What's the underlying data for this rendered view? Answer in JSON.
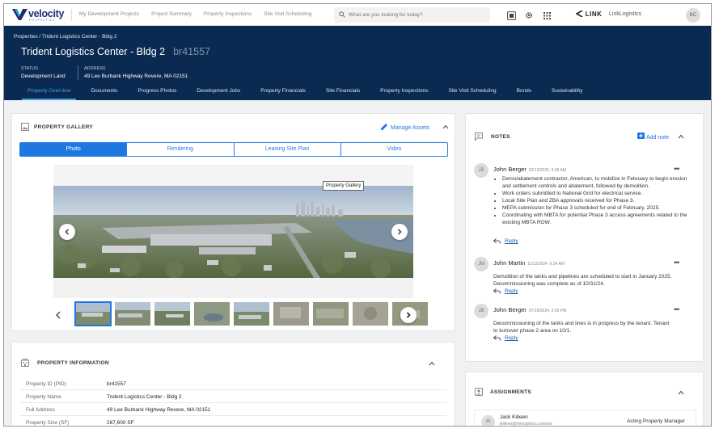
{
  "app": {
    "logo_text": "velocity",
    "logo_sub": "PROPERTIES",
    "nav": [
      "My Development Projects",
      "Project Summary",
      "Property Inspections",
      "Site Visit Scheduling"
    ],
    "search_placeholder": "What are you looking for today?",
    "partner_logo": "LINK",
    "tenant_name": "LinkLogistics",
    "user_initials": "BC"
  },
  "header": {
    "breadcrumb": "Properties / Trident Logistics Center - Bldg 2",
    "title": "Trident Logistics Center - Bldg 2",
    "property_code": "br41557",
    "status_label": "STATUS",
    "status_value": "Development Land",
    "address_label": "ADDRESS",
    "address_value": "49 Lee Burbank Highway Revere, MA 02151",
    "tabs": [
      "Property Overview",
      "Documents",
      "Progress Photos",
      "Development Jobs",
      "Property Financials",
      "Site Financials",
      "Property Inspections",
      "Site Visit Scheduling",
      "Bonds",
      "Sustainability"
    ],
    "active_tab": 0
  },
  "gallery": {
    "title": "PROPERTY GALLERY",
    "manage_label": "Manage Assets",
    "media_tabs": [
      "Photo",
      "Rendering",
      "Leasing Site Plan",
      "Video"
    ],
    "active_media_tab": 0,
    "tooltip": "Property Gallery",
    "thumbnail_count": 9
  },
  "info": {
    "title": "PROPERTY INFORMATION",
    "rows": [
      {
        "label": "Property ID (PID)",
        "value": "br41557"
      },
      {
        "label": "Property Name",
        "value": "Trident Logistics Center - Bldg 2"
      },
      {
        "label": "Full Address",
        "value": "49 Lee Burbank Highway Revere, MA 02151"
      },
      {
        "label": "Property Size (SF)",
        "value": "267,600 SF"
      }
    ]
  },
  "notes": {
    "title": "NOTES",
    "add_label": "Add note",
    "reply_label": "Reply",
    "items": [
      {
        "initials": "JB",
        "author": "John Berger",
        "date": "02/13/2025, 9:39 AM",
        "bullets": [
          "Demo/abatement contractor, American, to mobilize in February to begin erosion and settlement controls and abatement, followed by demolition.",
          "Work orders submitted to National Grid for electrical service.",
          "Local Site Plan and ZBA approvals received for Phase 3.",
          "MEPA submission for Phase 3 scheduled for end of February, 2025.",
          "Coordinating with MBTA for potential Phase 3 access agreements related to the existing MBTA ROW."
        ]
      },
      {
        "initials": "JM",
        "author": "John Martin",
        "date": "11/13/2024, 9:34 AM",
        "text": "Demolition of the tanks and pipelines are scheduled to start in January 2025. Decommissioning was complete as of 10/31/24."
      },
      {
        "initials": "JB",
        "author": "John Berger",
        "date": "07/19/2024, 2:09 PM",
        "text": "Decommissioning of the tanks and lines is in progress by the tenant. Tenant to turnover phase 2 area on 10/1."
      }
    ]
  },
  "assignments": {
    "title": "ASSIGNMENTS",
    "items": [
      {
        "initials": "JK",
        "name": "Jack Killeen",
        "email": "jkilleen@linklogistics.comtest",
        "role": "Acting Property Manager"
      }
    ]
  }
}
